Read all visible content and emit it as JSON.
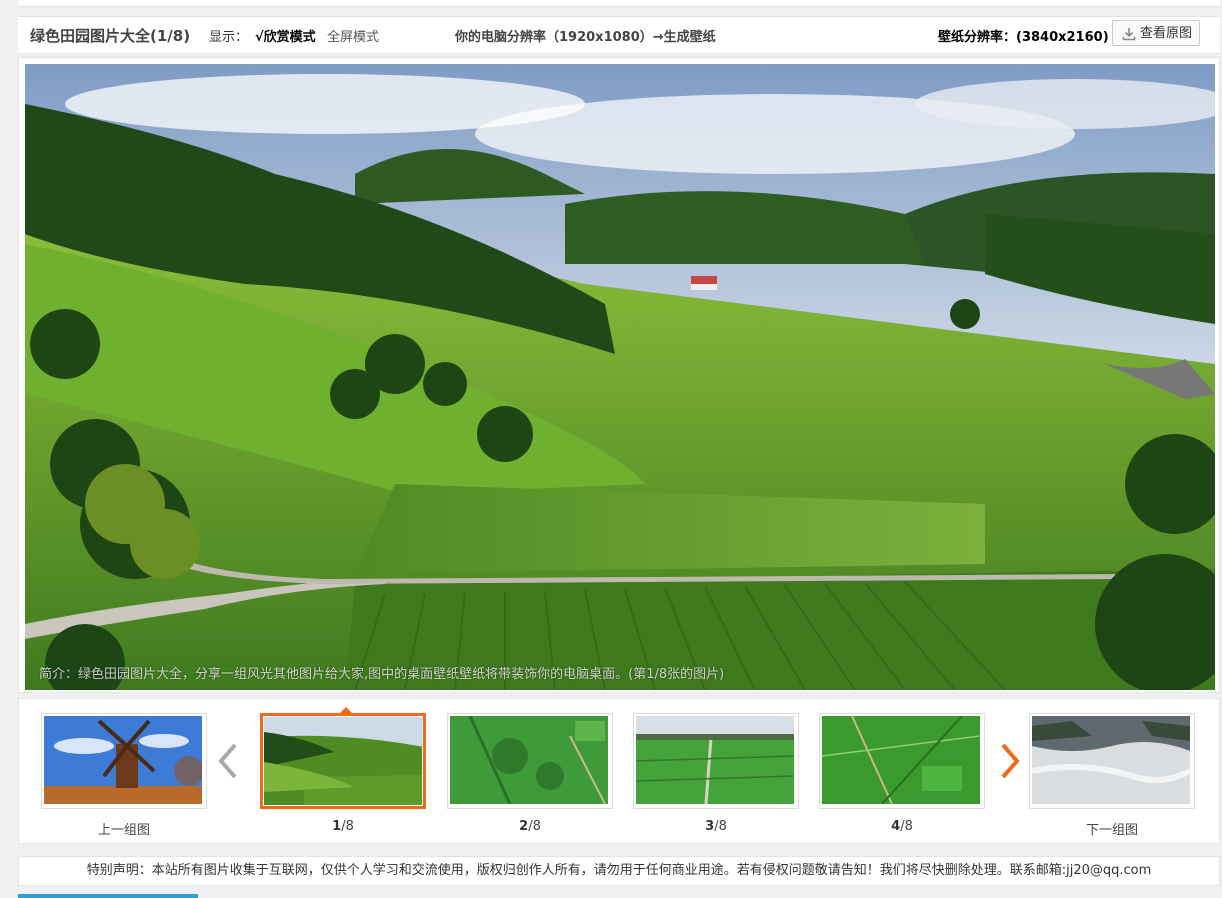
{
  "toolbar": {
    "title": "绿色田园图片大全(1/8)",
    "display_label": "显示：",
    "mode_appreciate": "√欣赏模式",
    "mode_fullscreen": "全屏模式",
    "computer_resolution": "你的电脑分辨率（1920x1080）→生成壁纸",
    "wallpaper_resolution": "壁纸分辨率：(3840x2160)",
    "view_original": "查看原图"
  },
  "photo": {
    "caption": "简介：绿色田园图片大全，分享一组风光其他图片给大家,图中的桌面壁纸壁纸将带装饰你的电脑桌面。(第1/8张的图片)"
  },
  "thumbnails": {
    "prev_group": "上一组图",
    "next_group": "下一组图",
    "items": [
      {
        "index": "1",
        "total": "/8"
      },
      {
        "index": "2",
        "total": "/8"
      },
      {
        "index": "3",
        "total": "/8"
      },
      {
        "index": "4",
        "total": "/8"
      }
    ]
  },
  "notice": "特别声明：本站所有图片收集于互联网，仅供个人学习和交流使用，版权归创作人所有，请勿用于任何商业用途。若有侵权问题敬请告知！我们将尽快删除处理。联系邮箱:jj20@qq.com",
  "colors": {
    "accent": "#f06a1a",
    "bottom_bar": "#2aa0d8"
  }
}
